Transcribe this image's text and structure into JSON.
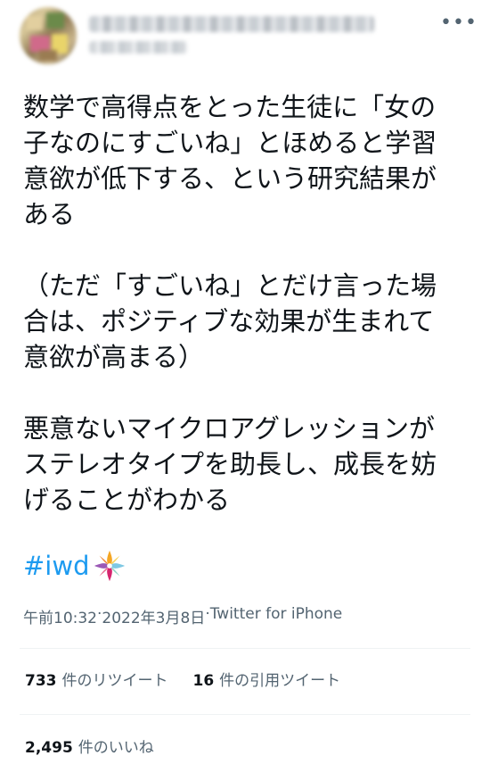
{
  "header": {
    "more_icon": "more-horizontal-icon",
    "more_label": "•••"
  },
  "tweet": {
    "text": "数学で高得点をとった生徒に「女の\n子なのにすごいね」とほめると学習\n意欲が低下する、という研究結果が\nある\n\n（ただ「すごいね」とだけ言った場\n合は、ポジティブな効果が生まれて\n意欲が高まる）\n\n悪意ないマイクロアグレッションが\nステレオタイプを助長し、成長を妨\nげることがわかる",
    "hashtag": "#iwd",
    "hashflag_icon": "iwd-flower-icon",
    "time": "午前10:32",
    "separator1": " · ",
    "date": "2022年3月8日",
    "separator2": " · ",
    "source": "Twitter for iPhone"
  },
  "stats": {
    "retweets_count": "733",
    "retweets_label": "件のリツイート",
    "quotes_count": "16",
    "quotes_label": "件の引用ツイート",
    "likes_count": "2,495",
    "likes_label": "件のいいね"
  },
  "colors": {
    "text": "#0f1419",
    "secondary": "#536471",
    "link": "#1d9bf0",
    "divider": "#eff3f4"
  }
}
